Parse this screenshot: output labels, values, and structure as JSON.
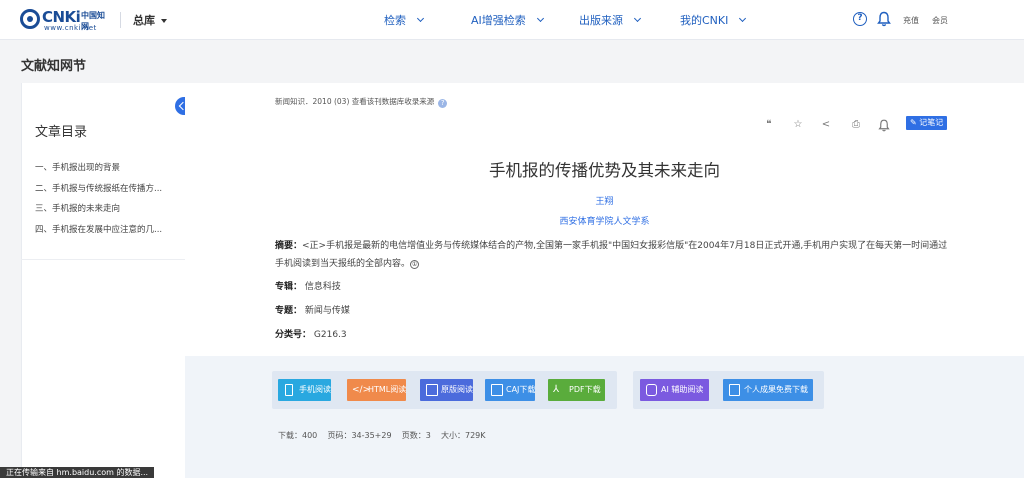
{
  "header": {
    "logo_main": "CNKi",
    "logo_cn": "中国知网",
    "logo_url": "www.cnki.net",
    "database_select": "总库",
    "nav": [
      "检索",
      "AI增强检索",
      "出版来源",
      "我的CNKI"
    ],
    "help_icon": "question-circle-icon",
    "bell_icon": "bell-icon",
    "recharge": "充值",
    "member": "会员"
  },
  "page": {
    "title": "文献知网节"
  },
  "sidebar": {
    "title": "文章目录",
    "items": [
      "一、手机报出现的背景",
      "二、手机报与传统报纸在传播方...",
      "三、手机报的未来走向",
      "四、手机报在发展中应注意的几..."
    ]
  },
  "article": {
    "breadcrumb": "新闻知识．2010 (03)  查看该刊数据库收录来源",
    "tools": [
      "quote-icon",
      "star-icon",
      "share-icon",
      "print-icon",
      "bell-icon"
    ],
    "note_button": "记笔记",
    "title": "手机报的传播优势及其未来走向",
    "author": "王翔",
    "organization": "西安体育学院人文学系",
    "abstract_label": "摘要：",
    "abstract_text": "<正>手机报是最新的电信增值业务与传统媒体结合的产物,全国第一家手机报\"中国妇女报彩信版\"在2004年7月18日正式开通,手机用户实现了在每天第一时间通过手机阅读到当天报纸的全部内容。",
    "abstract_note": "①",
    "fields": [
      {
        "label": "专辑：",
        "value": "信息科技"
      },
      {
        "label": "专题：",
        "value": "新闻与传媒"
      },
      {
        "label": "分类号：",
        "value": "G216.3"
      }
    ]
  },
  "downloads": {
    "buttons": [
      {
        "label": "手机阅读",
        "color": "#29a8e0"
      },
      {
        "label": "HTML阅读",
        "color": "#f08a4b"
      },
      {
        "label": "原版阅读",
        "color": "#4b6bdc"
      },
      {
        "label": "CAJ下载",
        "color": "#3d8fe6"
      },
      {
        "label": "PDF下载",
        "color": "#5aac3c"
      }
    ],
    "ai_buttons": [
      {
        "label": "AI 辅助阅读",
        "color": "#7b5ae0"
      },
      {
        "label": "个人成果免费下载",
        "color": "#3d8fe6"
      }
    ],
    "stats": "下载：400    页码：34-35+29    页数：3    大小：729K"
  },
  "status_bar": "正在传输来自 hm.baidu.com 的数据..."
}
